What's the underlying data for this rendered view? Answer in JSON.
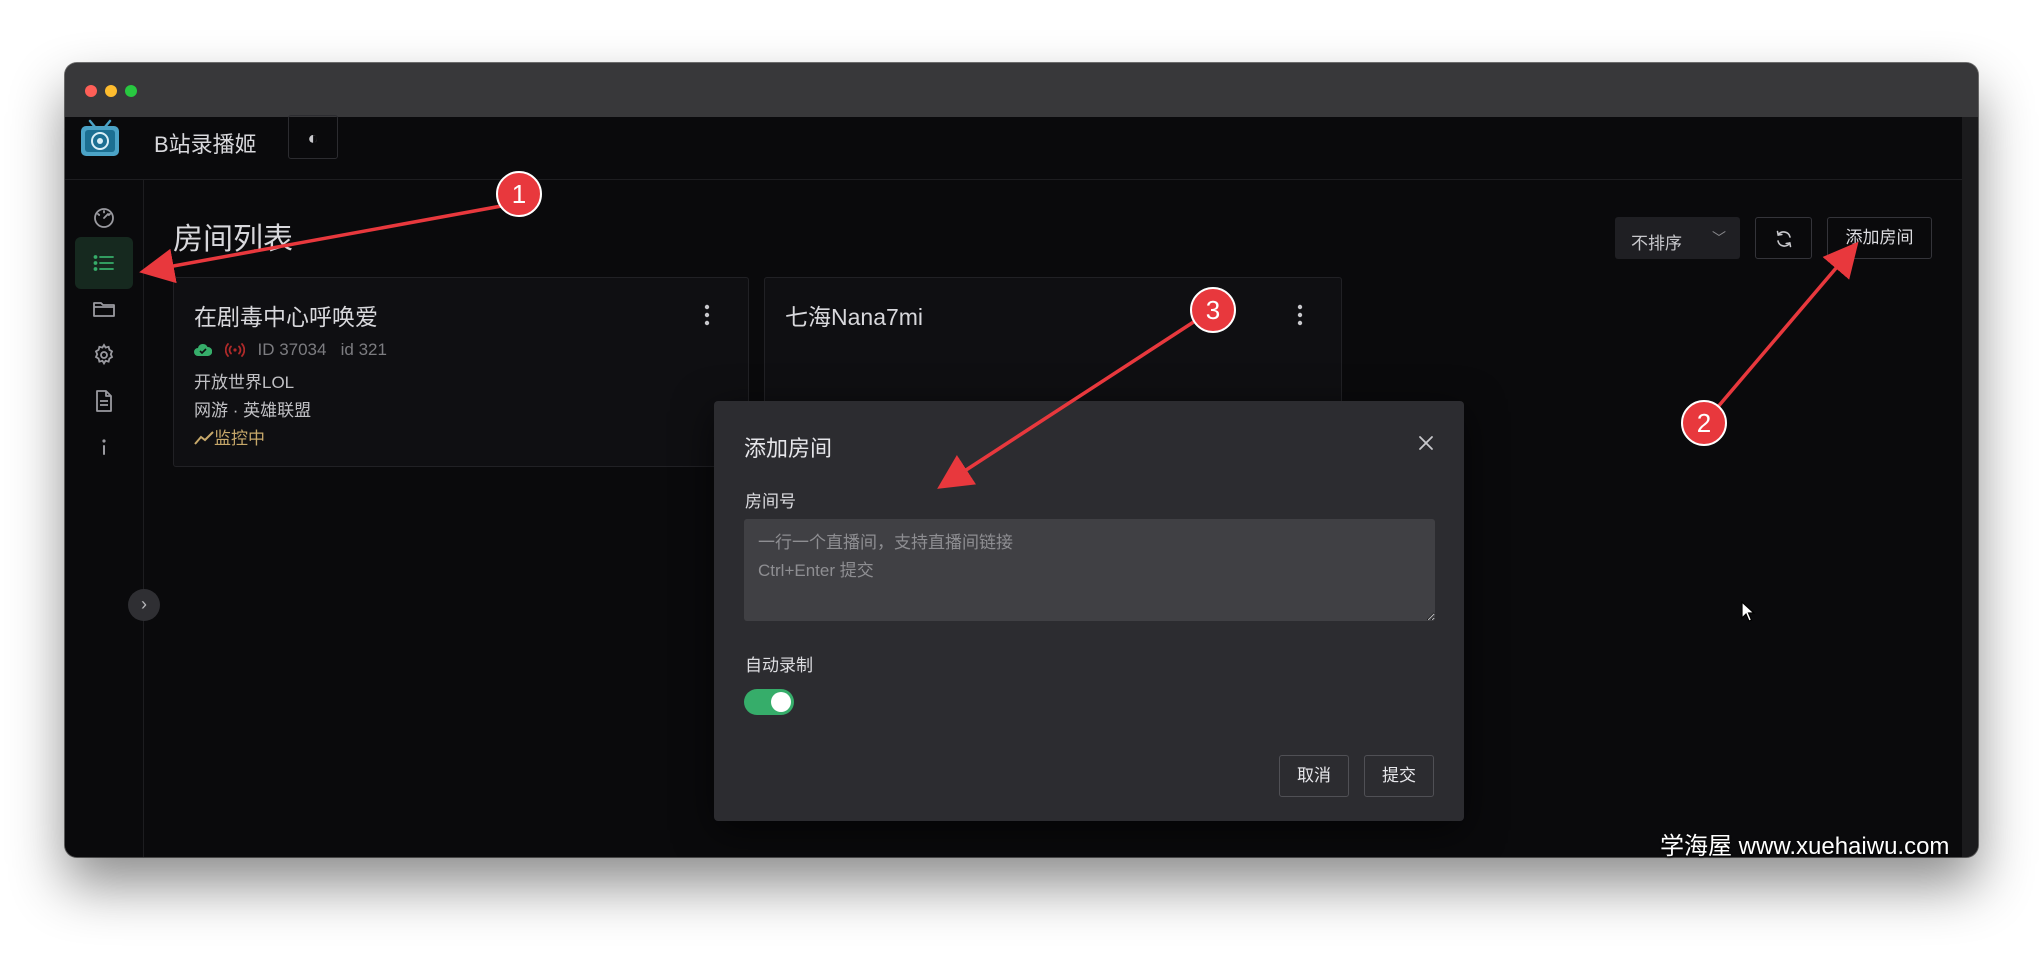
{
  "app": {
    "title": "B站录播姬",
    "theme_toggle_icon": "◐"
  },
  "sidebar": {
    "items": [
      {
        "name": "dashboard",
        "icon": "speedometer-icon"
      },
      {
        "name": "room-list",
        "icon": "list-icon",
        "active": true
      },
      {
        "name": "files",
        "icon": "folder-icon"
      },
      {
        "name": "settings",
        "icon": "gear-icon"
      },
      {
        "name": "logs",
        "icon": "document-icon"
      },
      {
        "name": "about",
        "icon": "info-icon"
      }
    ],
    "collapse_icon": "›"
  },
  "page": {
    "title": "房间列表",
    "sort_label": "不排序",
    "add_room_label": "添加房间"
  },
  "rooms": [
    {
      "name": "在剧毒中心呼唤爱",
      "room_id": "ID 37034",
      "short_id": "id 321",
      "title": "开放世界LOL",
      "category": "网游 · 英雄联盟",
      "status": "监控中"
    },
    {
      "name": "七海Nana7mi"
    }
  ],
  "modal": {
    "title": "添加房间",
    "room_label": "房间号",
    "room_placeholder": "一行一个直播间，支持直播间链接\nCtrl+Enter 提交",
    "room_value": "",
    "auto_record_label": "自动录制",
    "auto_record_on": true,
    "cancel_label": "取消",
    "submit_label": "提交"
  },
  "annotations": [
    {
      "num": "1"
    },
    {
      "num": "2"
    },
    {
      "num": "3"
    }
  ],
  "watermark": {
    "cn": "学海屋",
    "url": "www.xuehaiwu.com"
  },
  "colors": {
    "accent": "#36ad6a",
    "annotation_red": "#e8383d",
    "background": "#0a0a0c",
    "modal_bg": "#2c2c30"
  }
}
